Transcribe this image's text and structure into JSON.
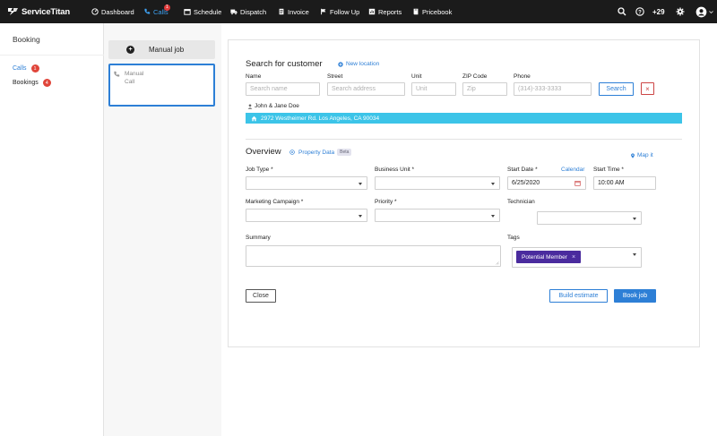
{
  "nav": {
    "brand": "ServiceTitan",
    "items": [
      {
        "label": "Dashboard",
        "icon": "dashboard-icon"
      },
      {
        "label": "Calls",
        "icon": "phone-icon",
        "badge": "1",
        "active": true
      },
      {
        "label": "Schedule",
        "icon": "calendar-icon"
      },
      {
        "label": "Dispatch",
        "icon": "truck-icon"
      },
      {
        "label": "Invoice",
        "icon": "invoice-icon"
      },
      {
        "label": "Follow Up",
        "icon": "flag-icon"
      },
      {
        "label": "Reports",
        "icon": "reports-icon"
      },
      {
        "label": "Pricebook",
        "icon": "book-icon"
      }
    ],
    "right": {
      "search_icon": "search-icon",
      "help_icon": "help-icon",
      "count": "+29",
      "settings_icon": "gear-icon",
      "avatar_icon": "user-avatar-icon"
    },
    "active_color": "#3ea0f0"
  },
  "sidebar": {
    "title": "Booking",
    "items": [
      {
        "label": "Calls",
        "badge": "1",
        "active": true
      },
      {
        "label": "Bookings",
        "badge": "4"
      }
    ]
  },
  "calls": {
    "manual_button": "Manual job",
    "card": {
      "line1": "Manual",
      "line2": "Call"
    }
  },
  "search": {
    "title": "Search for customer",
    "new_location": "New location",
    "fields": {
      "name": {
        "label": "Name",
        "placeholder": "Search name"
      },
      "street": {
        "label": "Street",
        "placeholder": "Search address"
      },
      "unit": {
        "label": "Unit",
        "placeholder": "Unit"
      },
      "zip": {
        "label": "ZIP Code",
        "placeholder": "Zip"
      },
      "phone": {
        "label": "Phone",
        "placeholder": "(314)-333-3333"
      }
    },
    "search_button": "Search",
    "clear_button": "×",
    "customer": "John & Jane Doe",
    "address": "2972 Westheimer Rd. Los Angeles, CA 90034"
  },
  "overview": {
    "title": "Overview",
    "property_data": "Property Data",
    "beta": "Beta",
    "map_it": "Map it",
    "job_type": {
      "label": "Job Type *",
      "value": ""
    },
    "business_unit": {
      "label": "Business Unit *",
      "value": ""
    },
    "start_date": {
      "label": "Start Date *",
      "value": "6/25/2020"
    },
    "calendar_link": "Calendar",
    "start_time": {
      "label": "Start Time *",
      "value": "10:00 AM"
    },
    "marketing": {
      "label": "Marketing Campaign *",
      "value": ""
    },
    "priority": {
      "label": "Priority *",
      "value": ""
    },
    "technician": {
      "label": "Technician",
      "value": ""
    },
    "summary": {
      "label": "Summary",
      "value": ""
    },
    "tags": {
      "label": "Tags",
      "selected": [
        "Potential Member"
      ],
      "remove": "×"
    }
  },
  "actions": {
    "close": "Close",
    "build_estimate": "Build estimate",
    "book_job": "Book job"
  },
  "colors": {
    "primary": "#2d7fd6",
    "address_bar": "#3cc4e8",
    "tag": "#4a2b9e",
    "badge": "#e0453a"
  }
}
